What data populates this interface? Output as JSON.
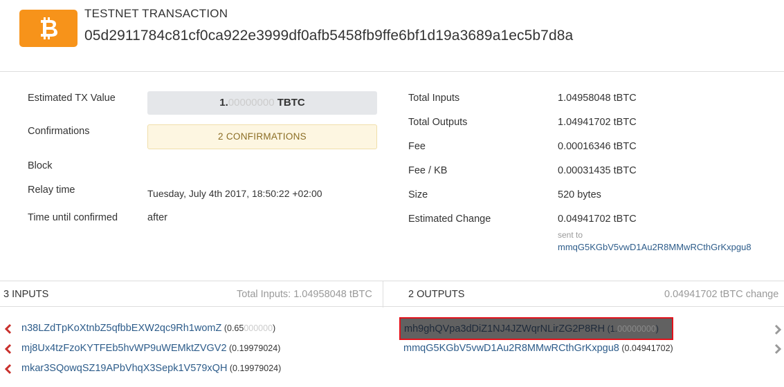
{
  "header": {
    "type_label": "TESTNET TRANSACTION",
    "tx_hash": "05d2911784c81cf0ca922e3999df0afb5458fb9ffe6bf1d19a3689a1ec5b7d8a",
    "logo_icon": "bitcoin-logo-icon",
    "logo_color": "#f7931a"
  },
  "details_left": {
    "estimated_value_label": "Estimated TX Value",
    "estimated_value_main": "1.",
    "estimated_value_faded": "00000000",
    "estimated_value_unit": " TBTC",
    "confirmations_label": "Confirmations",
    "confirmations_value": "2 CONFIRMATIONS",
    "block_label": "Block",
    "relay_time_label": "Relay time",
    "relay_time_value": "Tuesday, July 4th 2017, 18:50:22 +02:00",
    "time_until_label": "Time until confirmed",
    "time_until_value": "after"
  },
  "details_right": {
    "total_inputs_label": "Total Inputs",
    "total_inputs_value": "1.04958048 tBTC",
    "total_outputs_label": "Total Outputs",
    "total_outputs_value": "1.04941702 tBTC",
    "fee_label": "Fee",
    "fee_value": "0.00016346 tBTC",
    "fee_kb_label": "Fee / KB",
    "fee_kb_value": "0.00031435 tBTC",
    "size_label": "Size",
    "size_value": "520 bytes",
    "est_change_label": "Estimated Change",
    "est_change_value": "0.04941702 tBTC",
    "sent_to_label": "sent to",
    "sent_to_address": "mmqG5KGbV5vwD1Au2R8MMwRCthGrKxpgu8"
  },
  "inputs": {
    "title": "3 INPUTS",
    "total": "Total Inputs: 1.04958048 tBTC",
    "items": [
      {
        "address": "n38LZdTpKoXtnbZ5qfbbEXW2qc9Rh1womZ",
        "amount_prefix": " (0.65",
        "amount_faded": "000000",
        "amount_suffix": ")"
      },
      {
        "address": "mj8Ux4tzFzoKYTFEb5hvWP9uWEMktZVGV2",
        "amount_prefix": " (0.19979024",
        "amount_faded": "",
        "amount_suffix": ")"
      },
      {
        "address": "mkar3SQowqSZ19APbVhqX3Sepk1V579xQH",
        "amount_prefix": " (0.19979024",
        "amount_faded": "",
        "amount_suffix": ")"
      }
    ]
  },
  "outputs": {
    "title": "2 OUTPUTS",
    "change": "0.04941702 tBTC change",
    "items": [
      {
        "address": "mh9ghQVpa3dDiZ1NJ4JZWqrNLirZG2P8RH",
        "amount_prefix": " (1.",
        "amount_faded": "00000000",
        "amount_suffix": ")",
        "highlighted": true
      },
      {
        "address": "mmqG5KGbV5vwD1Au2R8MMwRCthGrKxpgu8",
        "amount_prefix": " (0.04941702",
        "amount_faded": "",
        "amount_suffix": ")",
        "highlighted": false
      }
    ]
  },
  "colors": {
    "link": "#2d5c8a",
    "input_chevron": "#c9302c",
    "output_chevron": "#999999",
    "highlight_border": "#e2121b"
  }
}
